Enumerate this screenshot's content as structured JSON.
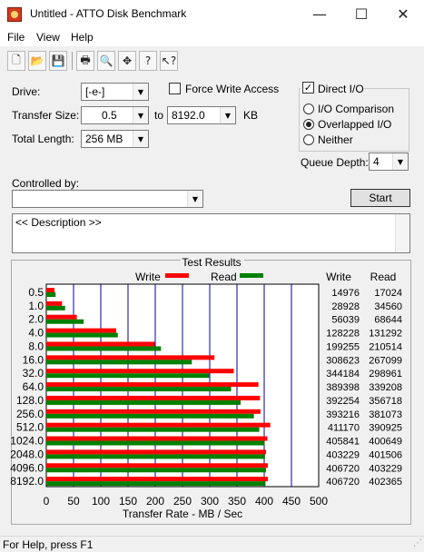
{
  "window": {
    "title": "Untitled - ATTO Disk Benchmark",
    "minimize": "—",
    "maximize": "☐",
    "close": "✕"
  },
  "menu": [
    "File",
    "View",
    "Help"
  ],
  "toolbar": [
    {
      "icon": "new-document-icon",
      "glyph": "🗋"
    },
    {
      "icon": "open-folder-icon",
      "glyph": "📂"
    },
    {
      "icon": "save-icon",
      "glyph": "💾"
    },
    {
      "icon": "print-icon",
      "glyph": "🖶"
    },
    {
      "icon": "print-preview-icon",
      "glyph": "🔍"
    },
    {
      "icon": "move-icon",
      "glyph": "✥"
    },
    {
      "icon": "help-icon",
      "glyph": "?"
    },
    {
      "icon": "context-help-icon",
      "glyph": "↖?"
    }
  ],
  "form": {
    "drive_label": "Drive:",
    "drive_value": "[-e-]",
    "force_write_label": "Force Write Access",
    "force_write_checked": false,
    "transfer_size_label": "Transfer Size:",
    "transfer_from": "0.5",
    "to_label": "to",
    "transfer_to": "8192.0",
    "kb_label": "KB",
    "total_length_label": "Total Length:",
    "total_length_value": "256 MB",
    "direct_io_label": "Direct I/O",
    "direct_io_checked": true,
    "io_comparison_label": "I/O Comparison",
    "overlapped_io_label": "Overlapped I/O",
    "neither_label": "Neither",
    "selected_mode": "Overlapped I/O",
    "queue_depth_label": "Queue Depth:",
    "queue_depth_value": "4",
    "controlled_by_label": "Controlled by:",
    "controlled_by_value": "",
    "start_label": "Start",
    "description": "<< Description >>"
  },
  "results": {
    "title": "Test Results",
    "write_legend": "Write",
    "read_legend": "Read",
    "write_col": "Write",
    "read_col": "Read"
  },
  "status": {
    "text": "For Help, press F1"
  },
  "chart_data": {
    "type": "bar",
    "orientation": "horizontal",
    "title": "Test Results",
    "xlabel": "Transfer Rate - MB / Sec",
    "xlim": [
      0,
      500
    ],
    "xticks": [
      0,
      50,
      100,
      150,
      200,
      250,
      300,
      350,
      400,
      450,
      500
    ],
    "grid": true,
    "legend_position": "top",
    "categories": [
      "0.5",
      "1.0",
      "2.0",
      "4.0",
      "8.0",
      "16.0",
      "32.0",
      "64.0",
      "128.0",
      "256.0",
      "512.0",
      "1024.0",
      "2048.0",
      "4096.0",
      "8192.0"
    ],
    "series": [
      {
        "name": "Write",
        "color": "#ff0000",
        "values": [
          14.976,
          28.928,
          56.039,
          128.228,
          199.255,
          308.623,
          344.184,
          389.398,
          392.254,
          393.216,
          411.17,
          405.841,
          403.229,
          406.72,
          406.72
        ],
        "labels": [
          "14976",
          "28928",
          "56039",
          "128228",
          "199255",
          "308623",
          "344184",
          "389398",
          "392254",
          "393216",
          "411170",
          "405841",
          "403229",
          "406720",
          "406720"
        ]
      },
      {
        "name": "Read",
        "color": "#008000",
        "values": [
          17.024,
          34.56,
          68.644,
          131.292,
          210.514,
          267.099,
          298.961,
          339.208,
          356.718,
          381.073,
          390.925,
          400.649,
          401.506,
          403.229,
          402.365
        ],
        "labels": [
          "17024",
          "34560",
          "68644",
          "131292",
          "210514",
          "267099",
          "298961",
          "339208",
          "356718",
          "381073",
          "390925",
          "400649",
          "401506",
          "403229",
          "402365"
        ]
      }
    ]
  }
}
